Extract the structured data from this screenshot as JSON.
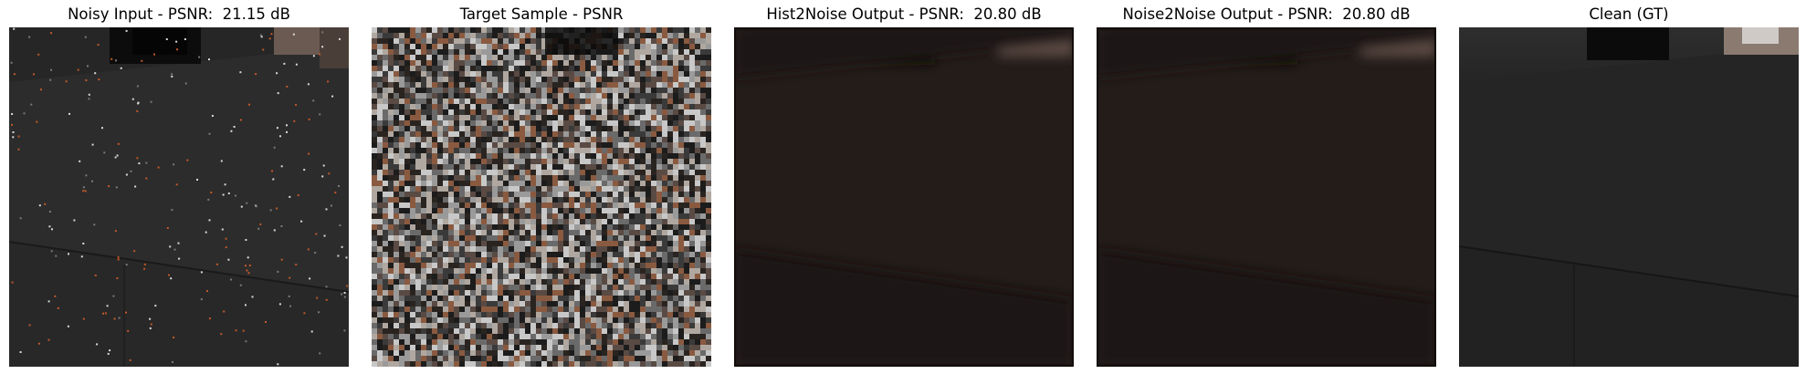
{
  "panels": [
    {
      "title": "Noisy Input - PSNR:  21.15 dB",
      "image": "noisy-input-image"
    },
    {
      "title": "Target Sample - PSNR",
      "image": "target-sample-image"
    },
    {
      "title": "Hist2Noise Output - PSNR:  20.80 dB",
      "image": "hist2noise-output-image"
    },
    {
      "title": "Noise2Noise Output - PSNR:  20.80 dB",
      "image": "noise2noise-output-image"
    },
    {
      "title": "Clean (GT)",
      "image": "clean-gt-image"
    }
  ],
  "colors": {
    "wall_dark": "#2a2a2a",
    "denoised_tint": "#231c19",
    "gap_dark": "#0c0c0c",
    "light_patch": "#cfcac6",
    "orange_speck": "#c2582a"
  }
}
